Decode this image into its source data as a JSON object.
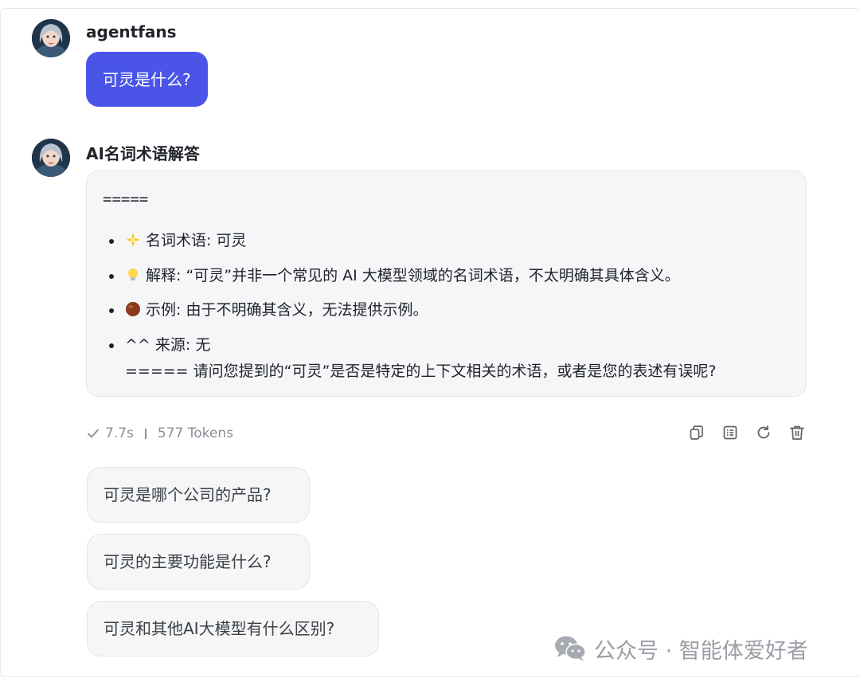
{
  "messages": {
    "user": {
      "name": "agentfans",
      "text": "可灵是什么?"
    },
    "assistant": {
      "name": "AI名词术语解答",
      "separator_top": "=====",
      "items": [
        {
          "icon": "sparkle-icon",
          "text": "名词术语: 可灵"
        },
        {
          "icon": "lightbulb-icon",
          "text": "解释: “可灵”并非一个常见的 AI 大模型领域的名词术语，不太明确其具体含义。"
        },
        {
          "icon": "chestnut-icon",
          "text": "示例: 由于不明确其含义，无法提供示例。"
        },
        {
          "icon": "",
          "text": "^^ 来源: 无",
          "line2": "===== 请问您提到的“可灵”是否是特定的上下文相关的术语，或者是您的表述有误呢?"
        }
      ]
    }
  },
  "meta": {
    "duration": "7.7s",
    "tokens": "577 Tokens"
  },
  "actions": [
    {
      "name": "copy-icon"
    },
    {
      "name": "document-icon"
    },
    {
      "name": "refresh-icon"
    },
    {
      "name": "trash-icon"
    }
  ],
  "suggestions": [
    "可灵是哪个公司的产品?",
    "可灵的主要功能是什么?",
    "可灵和其他AI大模型有什么区别?"
  ],
  "watermark": "公众号 · 智能体爱好者",
  "colors": {
    "accent": "#4a55e8",
    "card_bg": "#f5f6f8",
    "muted": "#8a8f98"
  }
}
